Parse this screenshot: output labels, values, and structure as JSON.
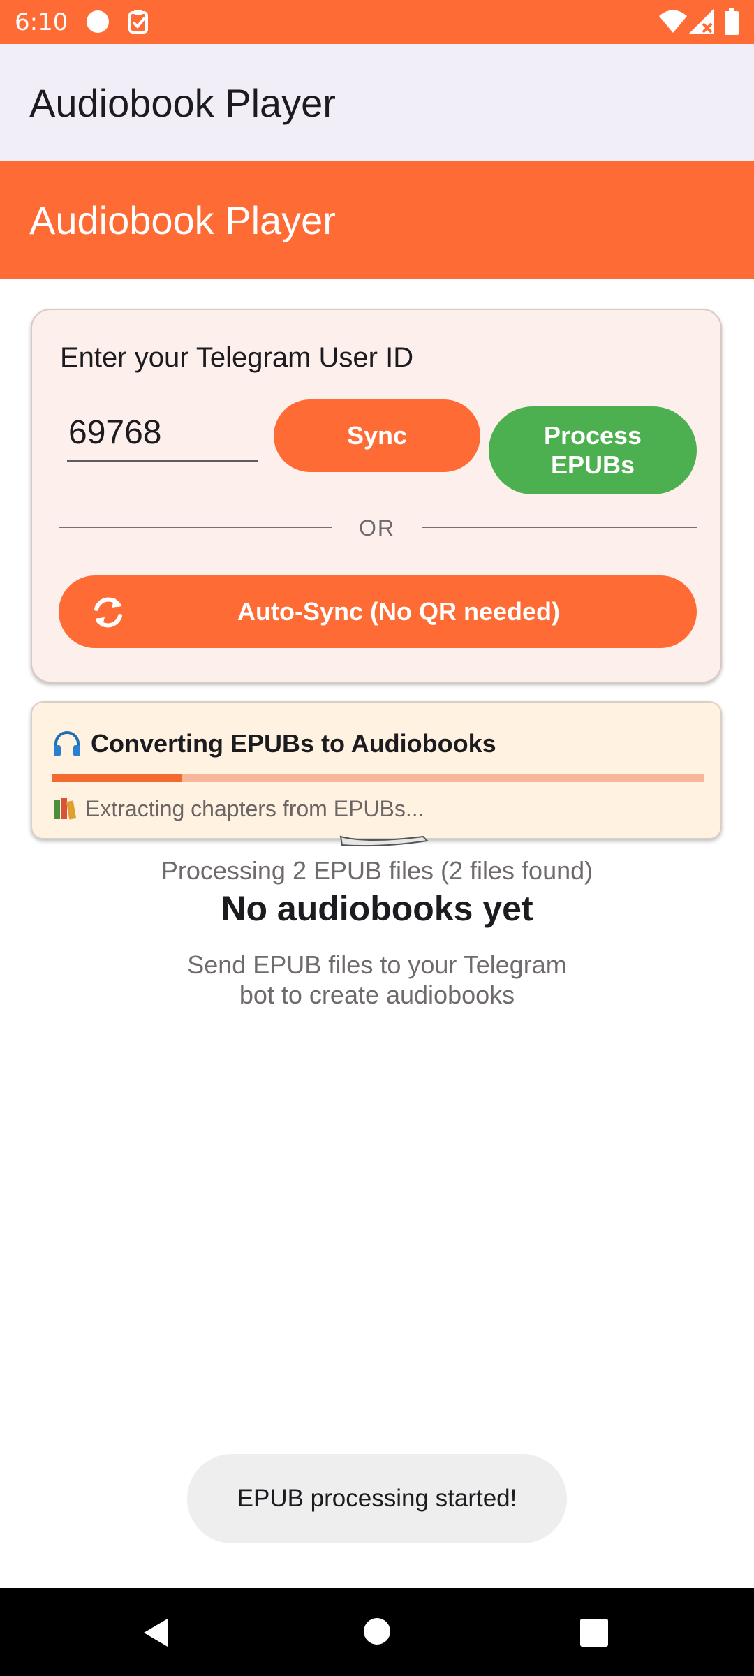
{
  "status_bar": {
    "time": "6:10"
  },
  "app_bar_top": {
    "title": "Audiobook Player"
  },
  "app_bar_main": {
    "title": "Audiobook Player"
  },
  "sync_card": {
    "label": "Enter your Telegram User ID",
    "user_id_value": "69768",
    "sync_button": "Sync",
    "process_button": "Process EPUBs",
    "divider_text": "OR",
    "auto_sync_button": "Auto-Sync (No QR needed)"
  },
  "progress_card": {
    "title": "Converting EPUBs to Audiobooks",
    "status": "Extracting chapters from EPUBs...",
    "progress_fraction": 0.2
  },
  "empty_state": {
    "processing_text": "Processing 2 EPUB files (2 files found)",
    "title": "No audiobooks yet",
    "subtitle": "Send EPUB files to your Telegram bot to create audiobooks"
  },
  "toast": {
    "message": "EPUB processing started!"
  },
  "colors": {
    "brand_orange": "#ff6b35",
    "success_green": "#4caf50",
    "progress_fill": "#f26a2f",
    "progress_track": "#f7b69a"
  },
  "icons": {
    "status_circle": "circle-icon",
    "status_task": "clipboard-check-icon",
    "wifi": "wifi-icon",
    "signal": "signal-icon",
    "battery": "battery-icon",
    "auto_sync": "sync-icon",
    "progress": "headphones-icon",
    "status_line": "books-icon",
    "nav_back": "back-icon",
    "nav_home": "home-icon",
    "nav_recents": "recents-icon"
  }
}
